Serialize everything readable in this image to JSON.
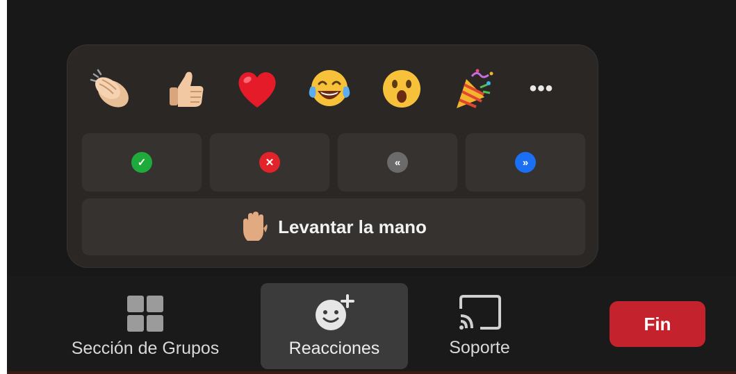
{
  "reactions": {
    "emojis": [
      {
        "name": "clapping-hands"
      },
      {
        "name": "thumbs-up"
      },
      {
        "name": "red-heart"
      },
      {
        "name": "tears-of-joy"
      },
      {
        "name": "surprised-face"
      },
      {
        "name": "party-popper"
      }
    ],
    "more_label": "•••",
    "feedback": [
      {
        "name": "yes",
        "symbol": "✓",
        "color": "#1faa3c"
      },
      {
        "name": "no",
        "symbol": "✕",
        "color": "#e2232a"
      },
      {
        "name": "slow-down",
        "symbol": "«",
        "color": "#6b6b6b"
      },
      {
        "name": "speed-up",
        "symbol": "»",
        "color": "#1b6ff5"
      }
    ],
    "raise_hand_label": "Levantar la mano"
  },
  "toolbar": {
    "breakout_label": "Sección de Grupos",
    "reactions_label": "Reacciones",
    "support_label": "Soporte",
    "end_label": "Fin"
  },
  "colors": {
    "end_button": "#c4222c",
    "popup_bg": "#2a2725",
    "button_bg": "#353230"
  }
}
